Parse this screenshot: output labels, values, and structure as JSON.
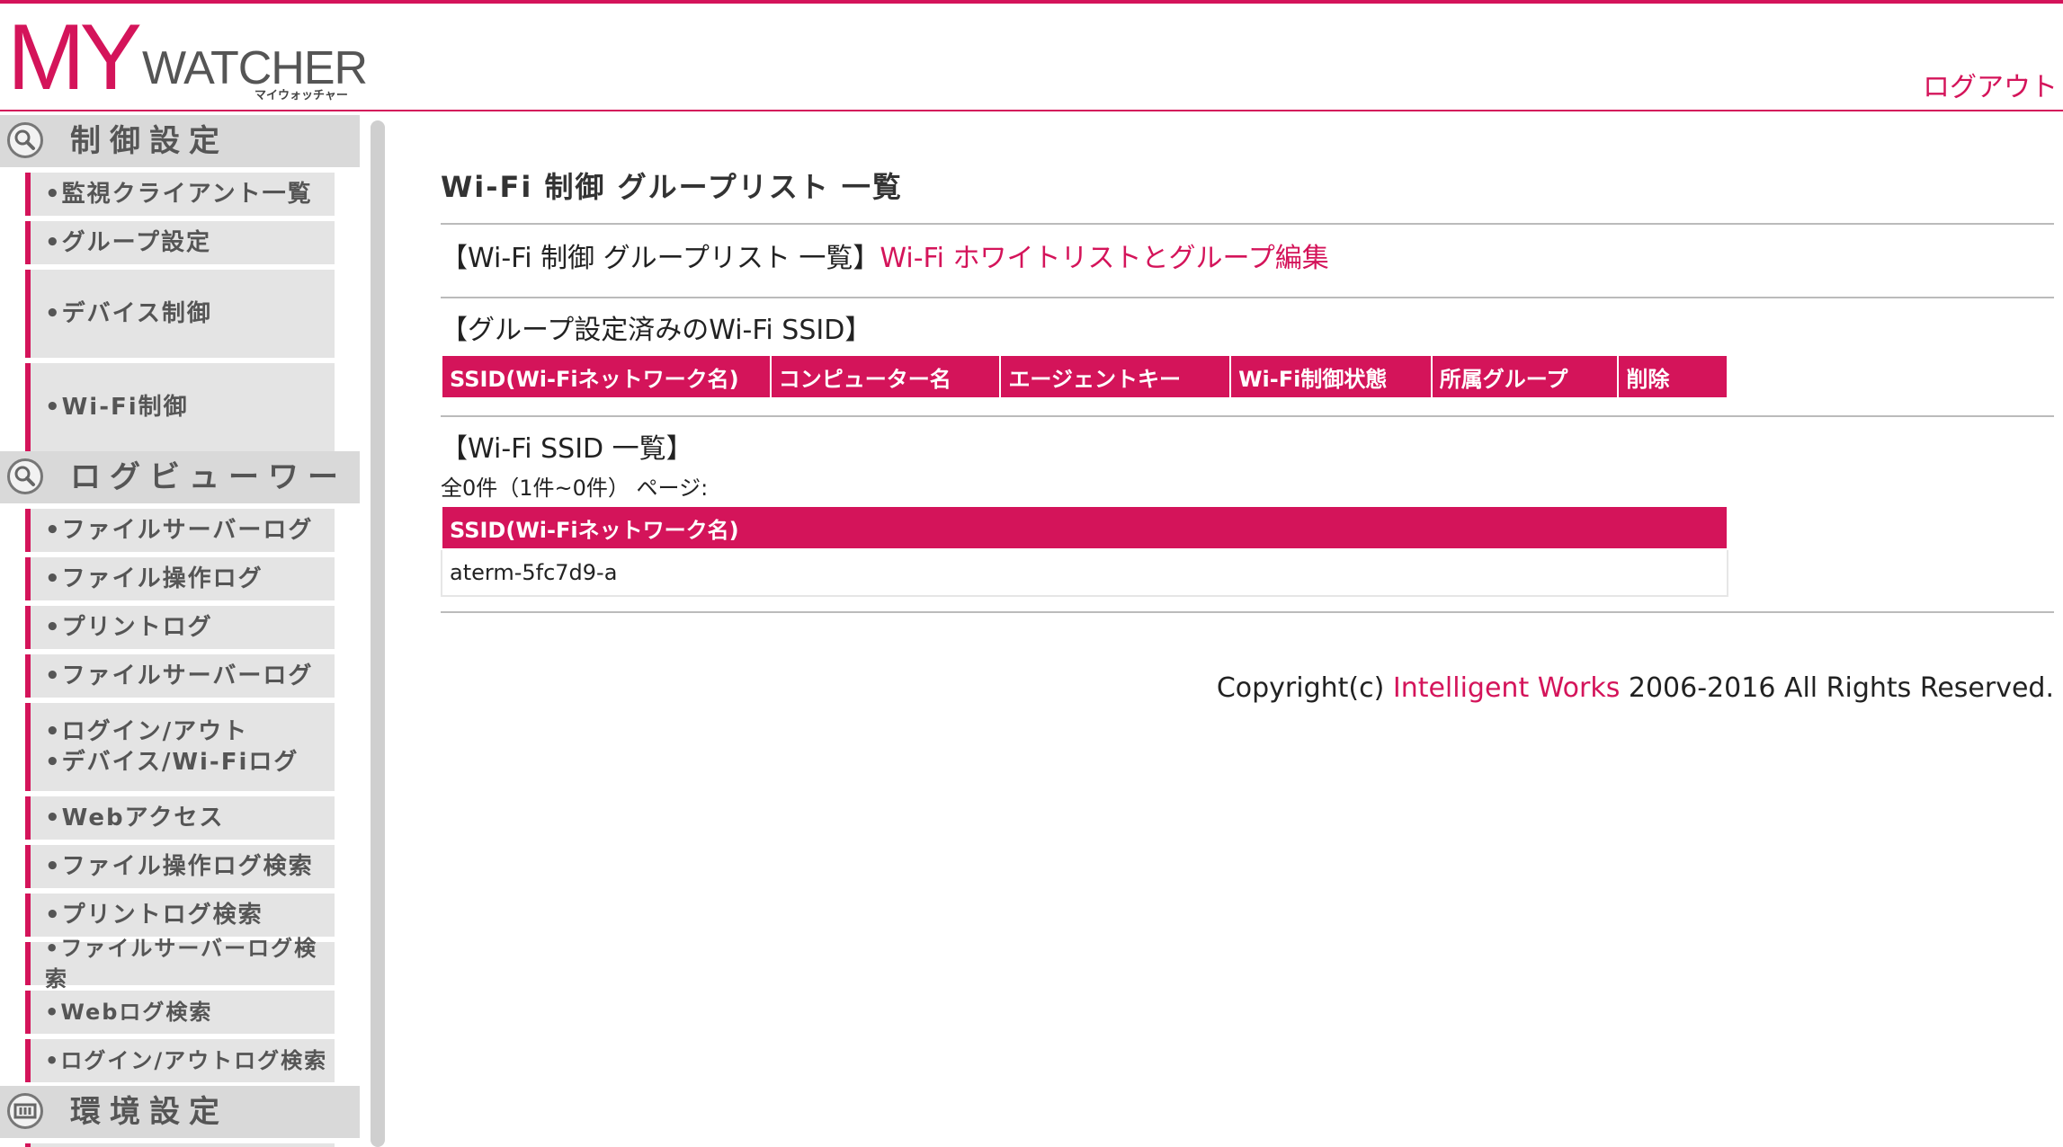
{
  "header": {
    "logo_my": "MY",
    "logo_watcher": "WATCHER",
    "logo_kana": "マイウォッチャー",
    "logout_label": "ログアウト"
  },
  "sidebar": {
    "sections": [
      {
        "label": "制御設定",
        "icon": "search-icon"
      },
      {
        "label": "ログビューワー",
        "icon": "search-icon"
      },
      {
        "label": "環境設定",
        "icon": "settings-panel-icon"
      }
    ],
    "control_items": [
      "•監視クライアント一覧",
      "•グループ設定",
      "•デバイス制御",
      "•Wi-Fi制御"
    ],
    "log_items": [
      "•ファイルサーバーログ",
      "•ファイル操作ログ",
      "•プリントログ",
      "•ファイルサーバーログ",
      "•ログイン/アウト",
      "•デバイス/Wi-Fiログ",
      "•Webアクセス",
      "•ファイル操作ログ検索",
      "•プリントログ検索",
      "•ファイルサーバーログ検索",
      "•Webログ検索",
      "•ログイン/アウトログ検索"
    ]
  },
  "main": {
    "page_title": "Wi-Fi 制御 グループリスト 一覧",
    "crumb_prefix": "【Wi-Fi 制御 グループリスト 一覧】",
    "crumb_link": "Wi-Fi ホワイトリストとグループ編集",
    "group_section_title": "【グループ設定済みのWi-Fi SSID】",
    "group_table_headers": [
      "SSID(Wi-Fiネットワーク名)",
      "コンピューター名",
      "エージェントキー",
      "Wi-Fi制御状態",
      "所属グループ",
      "削除"
    ],
    "ssid_section_title": "【Wi-Fi SSID 一覧】",
    "count_text": "全0件（1件~0件） ページ:",
    "ssid_table_header": "SSID(Wi-Fiネットワーク名)",
    "ssid_rows": [
      "aterm-5fc7d9-a"
    ]
  },
  "footer": {
    "copyright_prefix": "Copyright(c) ",
    "company_link": "Intelligent Works",
    "copyright_suffix": " 2006-2016 All Rights Reserved."
  },
  "colors": {
    "accent": "#d4145a",
    "sidebar_item_bg": "#e4e4e4",
    "section_bg": "#d9d9d9"
  }
}
